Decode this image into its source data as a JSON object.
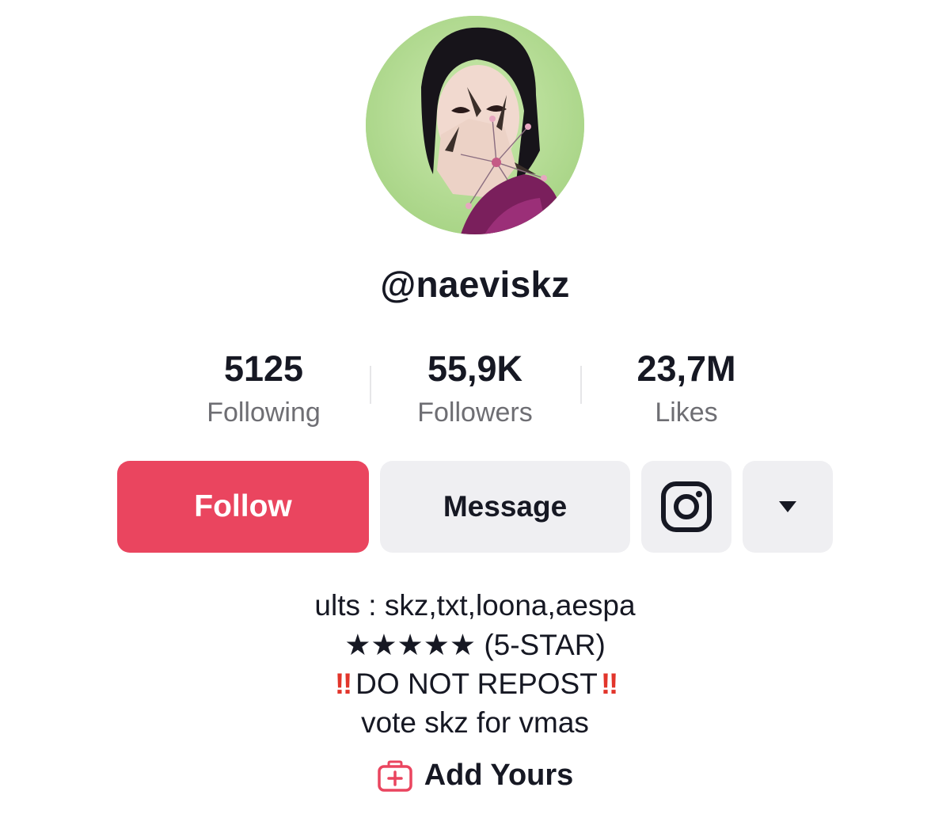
{
  "profile": {
    "username": "@naeviskz",
    "avatar_icon": "profile-photo"
  },
  "stats": [
    {
      "value": "5125",
      "label": "Following"
    },
    {
      "value": "55,9K",
      "label": "Followers"
    },
    {
      "value": "23,7M",
      "label": "Likes"
    }
  ],
  "actions": {
    "follow_label": "Follow",
    "message_label": "Message",
    "instagram_icon": "instagram-icon",
    "more_icon": "caret-down-icon"
  },
  "bio": {
    "line1": "ults : skz,txt,loona,aespa",
    "line2": "★★★★★ (5-STAR)",
    "line3_marks": "‼",
    "line3_text": "DO NOT REPOST",
    "line4": "vote skz for vmas"
  },
  "add_yours": {
    "label": "Add Yours",
    "icon": "add-yours-icon"
  },
  "colors": {
    "follow": "#ea455f",
    "secondary_button": "#efeff2",
    "warning": "#e2352b",
    "muted_text": "#6e6e73"
  }
}
